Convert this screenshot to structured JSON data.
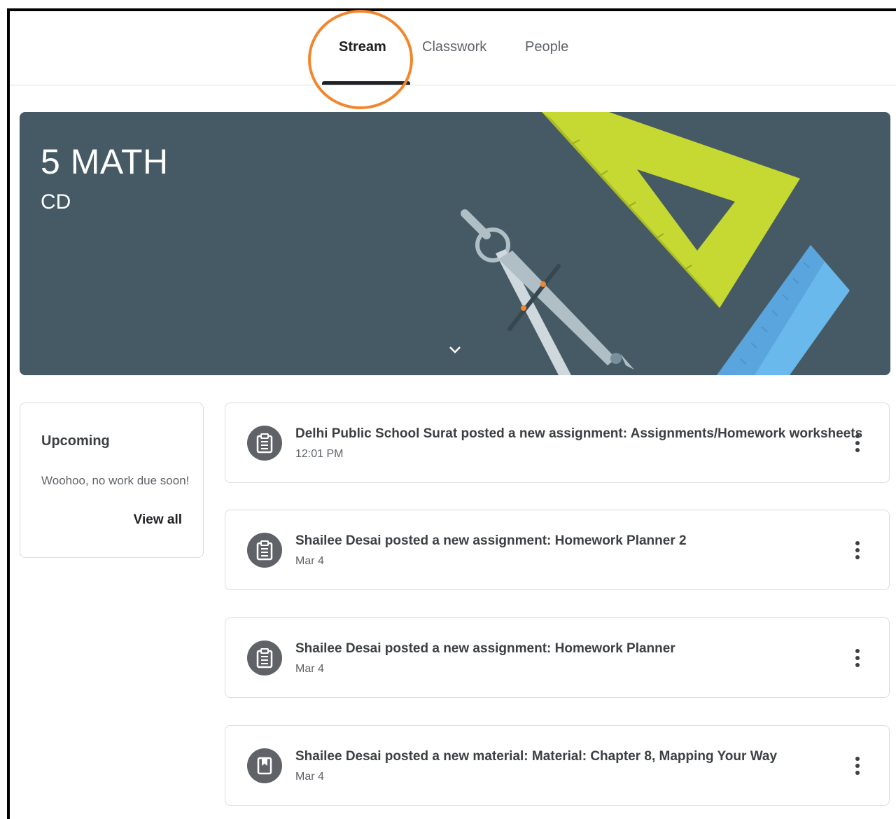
{
  "tabs": {
    "stream": "Stream",
    "classwork": "Classwork",
    "people": "People"
  },
  "banner": {
    "title": "5 MATH",
    "section": "CD",
    "expand_icon": "chevron-down-icon"
  },
  "upcoming": {
    "title": "Upcoming",
    "empty_message": "Woohoo, no work due soon!",
    "view_all": "View all"
  },
  "posts": [
    {
      "icon": "assignment-icon",
      "title": "Delhi Public School Surat posted a new assignment: Assignments/Homework worksheets",
      "date": "12:01 PM"
    },
    {
      "icon": "assignment-icon",
      "title": "Shailee Desai posted a new assignment: Homework Planner 2",
      "date": "Mar 4"
    },
    {
      "icon": "assignment-icon",
      "title": "Shailee Desai posted a new assignment: Homework Planner",
      "date": "Mar 4"
    },
    {
      "icon": "material-icon",
      "title": "Shailee Desai posted a new material: Material: Chapter 8, Mapping Your Way",
      "date": "Mar 4"
    }
  ],
  "colors": {
    "banner_bg": "#455a64",
    "highlight": "#f2862e",
    "set_square": "#c6d932",
    "ruler": "#6ab9ec"
  }
}
